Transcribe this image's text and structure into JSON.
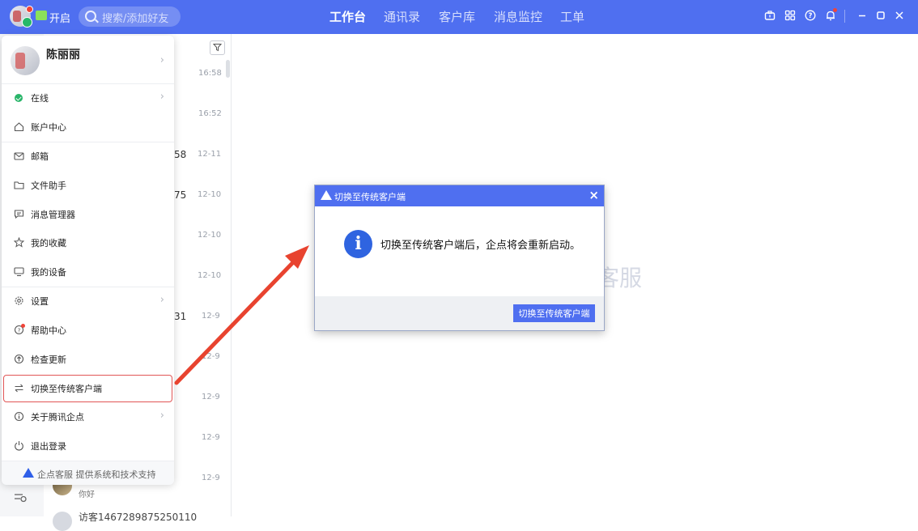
{
  "topbar": {
    "status_label": "开启",
    "search_placeholder": "搜索/添加好友",
    "tabs": [
      {
        "label": "工作台",
        "active": true
      },
      {
        "label": "通讯录"
      },
      {
        "label": "客户库"
      },
      {
        "label": "消息监控"
      },
      {
        "label": "工单"
      }
    ],
    "icons": [
      "briefcase-icon",
      "apps-grid-icon",
      "help-icon",
      "bell-icon",
      "minimize-icon",
      "maximize-icon",
      "close-icon"
    ]
  },
  "chat_list": {
    "times": [
      "16:58",
      "16:52",
      "12-11",
      "12-10",
      "12-10",
      "12-10",
      "12-9",
      "12-9",
      "12-9",
      "12-9",
      "12-9"
    ],
    "fragments": [
      "58",
      "75",
      "31"
    ],
    "last_preview": "你好",
    "partial_name": "访客1467289875250110"
  },
  "watermark": "客服",
  "menu": {
    "profile_name": "陈丽丽",
    "items": [
      {
        "label": "在线",
        "icon": "online-check-icon",
        "submenu": true
      },
      {
        "label": "账户中心",
        "icon": "home-icon"
      },
      {
        "label": "邮箱",
        "icon": "mail-icon"
      },
      {
        "label": "文件助手",
        "icon": "folder-icon"
      },
      {
        "label": "消息管理器",
        "icon": "message-icon"
      },
      {
        "label": "我的收藏",
        "icon": "star-icon"
      },
      {
        "label": "我的设备",
        "icon": "monitor-icon"
      },
      {
        "label": "设置",
        "icon": "gear-icon",
        "submenu": true
      },
      {
        "label": "帮助中心",
        "icon": "help-center-icon"
      },
      {
        "label": "检查更新",
        "icon": "upload-icon"
      },
      {
        "label": "切换至传统客户端",
        "icon": "switch-icon",
        "highlighted": true
      },
      {
        "label": "关于腾讯企点",
        "icon": "info-icon",
        "submenu": true
      },
      {
        "label": "退出登录",
        "icon": "power-icon"
      }
    ],
    "footer": "企点客服 提供系统和技术支持"
  },
  "dialog": {
    "title": "切换至传统客户端",
    "message": "切换至传统客户端后，企点将会重新启动。",
    "button": "切换至传统客户端"
  },
  "colors": {
    "brand": "#4f6ff0",
    "highlight_border": "#e15656",
    "arrow": "#e8432f",
    "online": "#2ab56a"
  }
}
